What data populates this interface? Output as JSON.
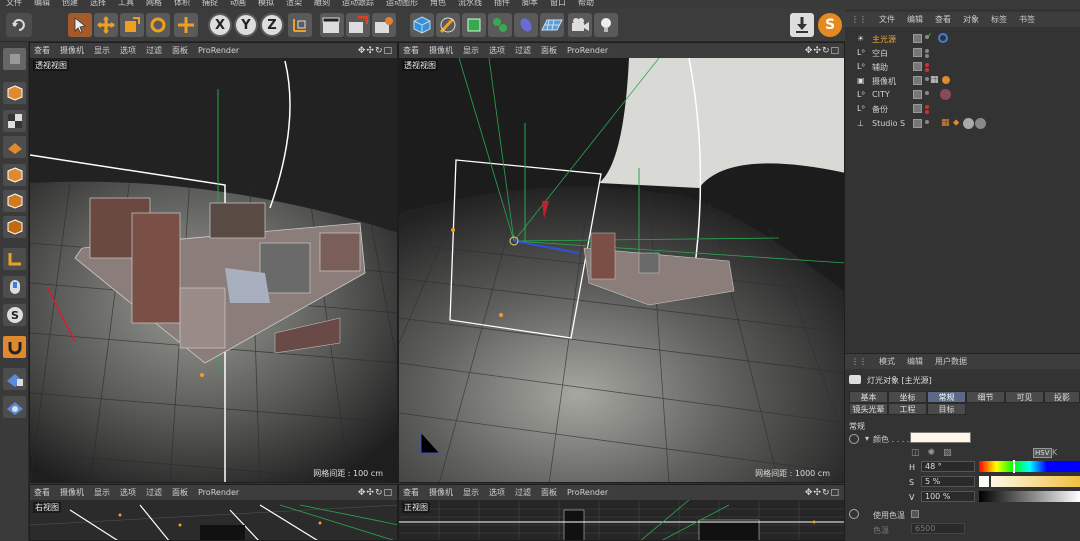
{
  "menubar": [
    "文件",
    "编辑",
    "创建",
    "选择",
    "工具",
    "网格",
    "体积",
    "捕捉",
    "动画",
    "模拟",
    "渲染",
    "雕刻",
    "运动跟踪",
    "运动图形",
    "角色",
    "流水线",
    "插件",
    "脚本",
    "窗口",
    "帮助"
  ],
  "toolbar": {
    "axis_x": "X",
    "axis_y": "Y",
    "axis_z": "Z",
    "icons": [
      "undo-icon",
      "pointer-icon",
      "move-icon",
      "scale-icon",
      "rotate-icon",
      "transform-icon",
      "axis-x-icon",
      "axis-y-icon",
      "axis-z-icon",
      "coordinate-system-icon",
      "render-view-icon",
      "render-picture-icon",
      "render-settings-icon",
      "cube-icon",
      "pen-icon",
      "subdivision-icon",
      "array-icon",
      "deformer-icon",
      "floor-icon",
      "camera-icon",
      "light-icon",
      "import-icon",
      "scene-icon"
    ]
  },
  "viewport_menu": [
    "查看",
    "摄像机",
    "显示",
    "选项",
    "过滤",
    "面板",
    "ProRender"
  ],
  "viewports": {
    "tl": {
      "name": "透视视图",
      "grid": "网格间距 : 100 cm"
    },
    "tr": {
      "name": "透视视图",
      "grid": "网格间距 : 1000 cm"
    },
    "bl": {
      "name": "右视图"
    },
    "br": {
      "name": "正视图"
    }
  },
  "object_manager": {
    "menu": [
      "文件",
      "编辑",
      "查看",
      "对象",
      "标签",
      "书签"
    ],
    "objects": [
      {
        "name": "主光源",
        "color": "#f0a830"
      },
      {
        "name": "空白",
        "color": "#d0d0d0"
      },
      {
        "name": "辅助",
        "color": "#d0d0d0"
      },
      {
        "name": "摄像机",
        "color": "#d0d0d0"
      },
      {
        "name": "CITY",
        "color": "#d0d0d0"
      },
      {
        "name": "备份",
        "color": "#d0d0d0"
      },
      {
        "name": "Studio S",
        "color": "#d0d0d0"
      }
    ]
  },
  "attribute_manager": {
    "menu": [
      "模式",
      "编辑",
      "用户数据"
    ],
    "title": "灯光对象 [主光源]",
    "tabs_row1": [
      "基本",
      "坐标",
      "常规",
      "细节",
      "可见",
      "投影"
    ],
    "tabs_row2": [
      "镜头光晕",
      "工程",
      "目标"
    ],
    "active_tab": "常规",
    "section": "常规",
    "color_label": "颜色 . . . . . . .",
    "H": {
      "label": "H",
      "value": "48 °"
    },
    "S": {
      "label": "S",
      "value": "5 %"
    },
    "V": {
      "label": "V",
      "value": "100 %"
    },
    "hsv_label": "HSV",
    "use_temp": "使用色温",
    "temp_label": "色温",
    "temp_value": "6500"
  }
}
